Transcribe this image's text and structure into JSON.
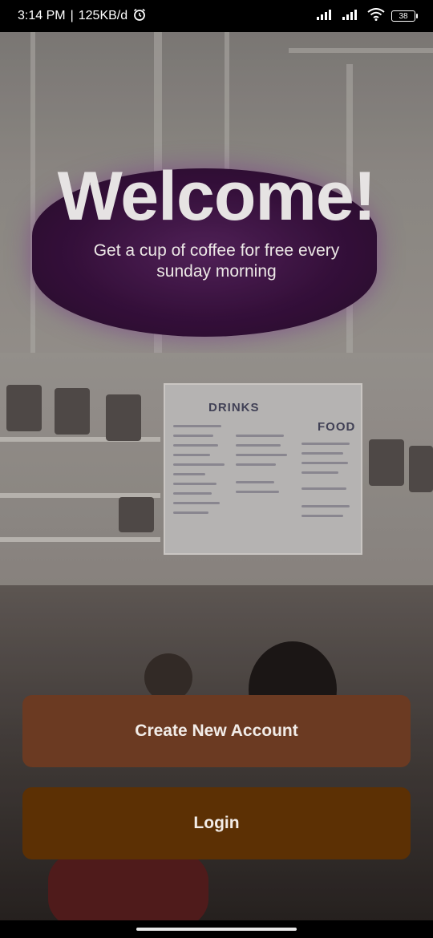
{
  "status_bar": {
    "time": "3:14 PM",
    "separator": "|",
    "net_speed": "125KB/d",
    "alarm_icon": "alarm-icon",
    "signal_icon": "signal-icon",
    "wifi_icon": "wifi-icon",
    "battery_level": "38"
  },
  "welcome": {
    "title": "Welcome!",
    "subtitle": "Get a cup of coffee for free every sunday morning"
  },
  "background_signage": {
    "menu_left": "DRINKS",
    "menu_right": "FOOD"
  },
  "actions": {
    "create_account_label": "Create New Account",
    "login_label": "Login"
  },
  "colors": {
    "create_button": "#6b3a22",
    "login_button": "#5c3004",
    "title_text": "#e6e3e3"
  }
}
